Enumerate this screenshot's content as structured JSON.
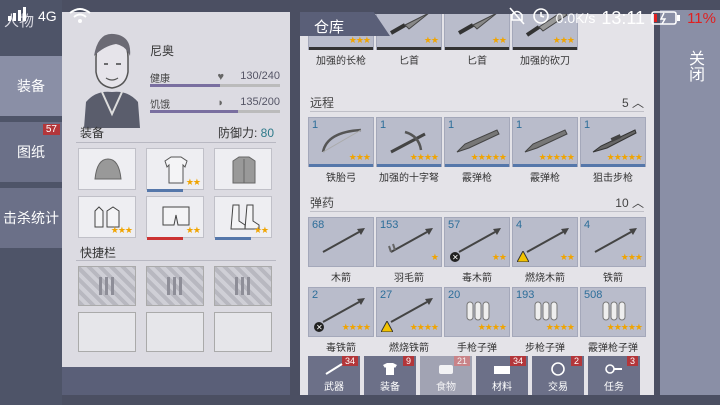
{
  "status": {
    "network": "4G",
    "speed": "0.0K/s",
    "time": "13:11",
    "battery": "11%",
    "battery_color": "#e02020"
  },
  "left_nav": {
    "title": "人物",
    "tabs": [
      {
        "label": "装备",
        "active": true
      },
      {
        "label": "图纸",
        "badge": "57"
      },
      {
        "label": "击杀统计"
      }
    ]
  },
  "character": {
    "name": "尼奥",
    "health_label": "健康",
    "health_value": "130/240",
    "health_ratio": 0.54,
    "hunger_label": "饥饿",
    "hunger_value": "135/200",
    "hunger_ratio": 0.675,
    "equip_label": "装备",
    "defense_label": "防御力:",
    "defense_value": "80",
    "quickbar_label": "快捷栏",
    "equipment": [
      {
        "icon": "beanie-icon",
        "stars": 0
      },
      {
        "icon": "shirt-icon",
        "stars": 2
      },
      {
        "icon": "jacket-icon",
        "stars": 0
      },
      {
        "icon": "gloves-icon",
        "stars": 3
      },
      {
        "icon": "shorts-icon",
        "stars": 2
      },
      {
        "icon": "boots-icon",
        "stars": 2
      }
    ]
  },
  "warehouse": {
    "title": "仓库",
    "top_items": [
      {
        "name": "加强的长枪",
        "stars": 3
      },
      {
        "name": "匕首",
        "stars": 2
      },
      {
        "name": "匕首",
        "stars": 2
      },
      {
        "name": "加强的砍刀",
        "stars": 3
      }
    ],
    "ranged": {
      "label": "远程",
      "count": "5",
      "items": [
        {
          "qty": "1",
          "name": "铁胎弓",
          "stars": 3
        },
        {
          "qty": "1",
          "name": "加强的十字弩",
          "stars": 4
        },
        {
          "qty": "1",
          "name": "霰弹枪",
          "stars": 5
        },
        {
          "qty": "1",
          "name": "霰弹枪",
          "stars": 5
        },
        {
          "qty": "1",
          "name": "狙击步枪",
          "stars": 5
        }
      ]
    },
    "ammo": {
      "label": "弹药",
      "count": "10",
      "items": [
        {
          "qty": "68",
          "name": "木箭",
          "stars": 0
        },
        {
          "qty": "153",
          "name": "羽毛箭",
          "stars": 1
        },
        {
          "qty": "57",
          "name": "毒木箭",
          "stars": 2,
          "warn": "poison"
        },
        {
          "qty": "4",
          "name": "燃烧木箭",
          "stars": 2,
          "warn": "fire"
        },
        {
          "qty": "4",
          "name": "铁箭",
          "stars": 3
        },
        {
          "qty": "2",
          "name": "毒铁箭",
          "stars": 4,
          "warn": "poison"
        },
        {
          "qty": "27",
          "name": "燃烧铁箭",
          "stars": 4,
          "warn": "fire"
        },
        {
          "qty": "20",
          "name": "手枪子弹",
          "stars": 4
        },
        {
          "qty": "193",
          "name": "步枪子弹",
          "stars": 4
        },
        {
          "qty": "508",
          "name": "霰弹枪子弹",
          "stars": 5
        }
      ]
    }
  },
  "bottom_tabs": [
    {
      "label": "武器",
      "badge": "34",
      "icon": "weapon-icon"
    },
    {
      "label": "装备",
      "badge": "9",
      "icon": "clothing-icon"
    },
    {
      "label": "食物",
      "badge": "21",
      "icon": "food-icon",
      "dim": true
    },
    {
      "label": "材料",
      "badge": "34",
      "icon": "material-icon"
    },
    {
      "label": "交易",
      "badge": "2",
      "icon": "trade-icon"
    },
    {
      "label": "任务",
      "badge": "3",
      "icon": "key-icon"
    }
  ],
  "close_label": "关闭"
}
